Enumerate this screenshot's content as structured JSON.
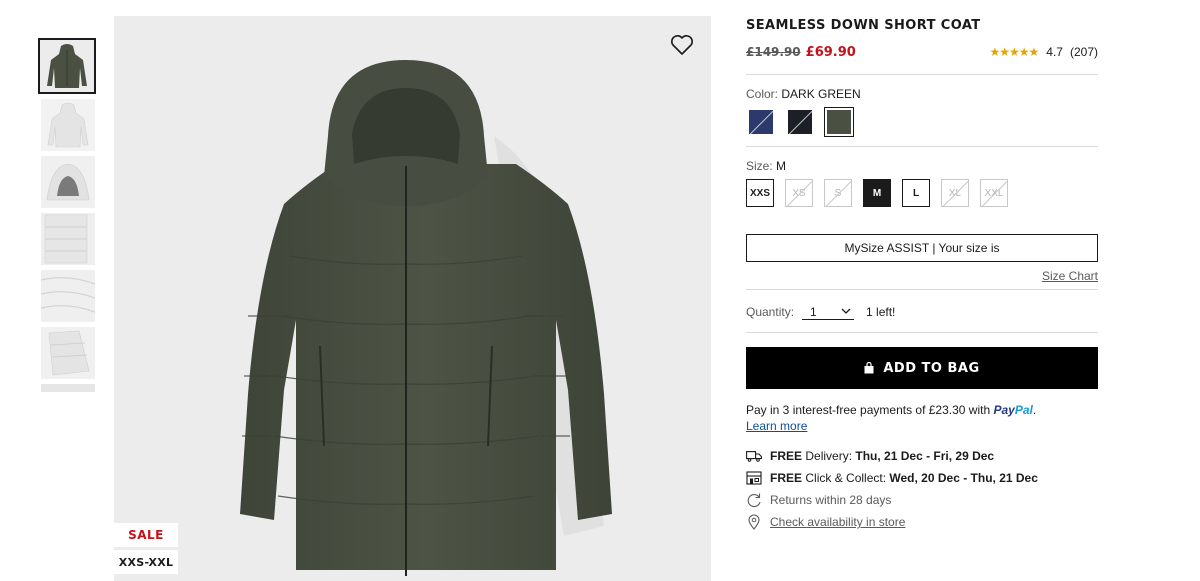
{
  "product": {
    "title": "SEAMLESS DOWN SHORT COAT",
    "old_price": "£149.90",
    "new_price": "£69.90",
    "rating_stars": "★★★★★",
    "rating_score": "4.7",
    "rating_count": "(207)",
    "rating_value": 4.7
  },
  "image": {
    "badges": {
      "sale": "SALE",
      "size_range": "XXS-XXL"
    }
  },
  "thumbnails": [
    {
      "name": "thumb-dark-green-coat",
      "selected": true
    },
    {
      "name": "thumb-white-coat-back",
      "selected": false
    },
    {
      "name": "thumb-hood-detail",
      "selected": false
    },
    {
      "name": "thumb-quilt-detail",
      "selected": false
    },
    {
      "name": "thumb-fabric-detail",
      "selected": false
    },
    {
      "name": "thumb-pocket-detail",
      "selected": false
    },
    {
      "name": "thumb-more",
      "selected": false
    }
  ],
  "color": {
    "label": "Color:",
    "value": "DARK GREEN",
    "swatches": [
      {
        "name": "navy",
        "hex": "#2b3a6b",
        "selected": false
      },
      {
        "name": "black",
        "hex": "#1d1f26",
        "selected": false
      },
      {
        "name": "dark-green",
        "hex": "#4a5143",
        "selected": true
      }
    ]
  },
  "size": {
    "label": "Size:",
    "value": "M",
    "options": [
      {
        "label": "XXS",
        "available": true,
        "selected": false
      },
      {
        "label": "XS",
        "available": false,
        "selected": false
      },
      {
        "label": "S",
        "available": false,
        "selected": false
      },
      {
        "label": "M",
        "available": true,
        "selected": true
      },
      {
        "label": "L",
        "available": true,
        "selected": false
      },
      {
        "label": "XL",
        "available": false,
        "selected": false
      },
      {
        "label": "XXL",
        "available": false,
        "selected": false
      }
    ],
    "mysize_label": "MySize ASSIST | Your size is",
    "size_chart_label": "Size Chart"
  },
  "quantity": {
    "label": "Quantity:",
    "value": "1",
    "stock_note": "1 left!"
  },
  "cart": {
    "add_to_bag_label": "ADD TO BAG"
  },
  "paypal": {
    "text": "Pay in 3 interest-free payments of £23.30 with",
    "brand_part1": "Pay",
    "brand_part2": "Pal",
    "period": ".",
    "learn_more": "Learn more"
  },
  "delivery": {
    "free_label": "FREE",
    "delivery_text": "Delivery:",
    "delivery_dates": "Thu, 21 Dec - Fri, 29 Dec",
    "collect_text": "Click & Collect:",
    "collect_dates": "Wed, 20 Dec - Thu, 21 Dec",
    "returns_text": "Returns within 28 days",
    "store_link": "Check availability in store"
  },
  "colors": {
    "sale_red": "#c4121a",
    "text_dark": "#1b1b1b",
    "button_black": "#000000",
    "coat_green": "#4a5143",
    "image_bg": "#ececec"
  }
}
